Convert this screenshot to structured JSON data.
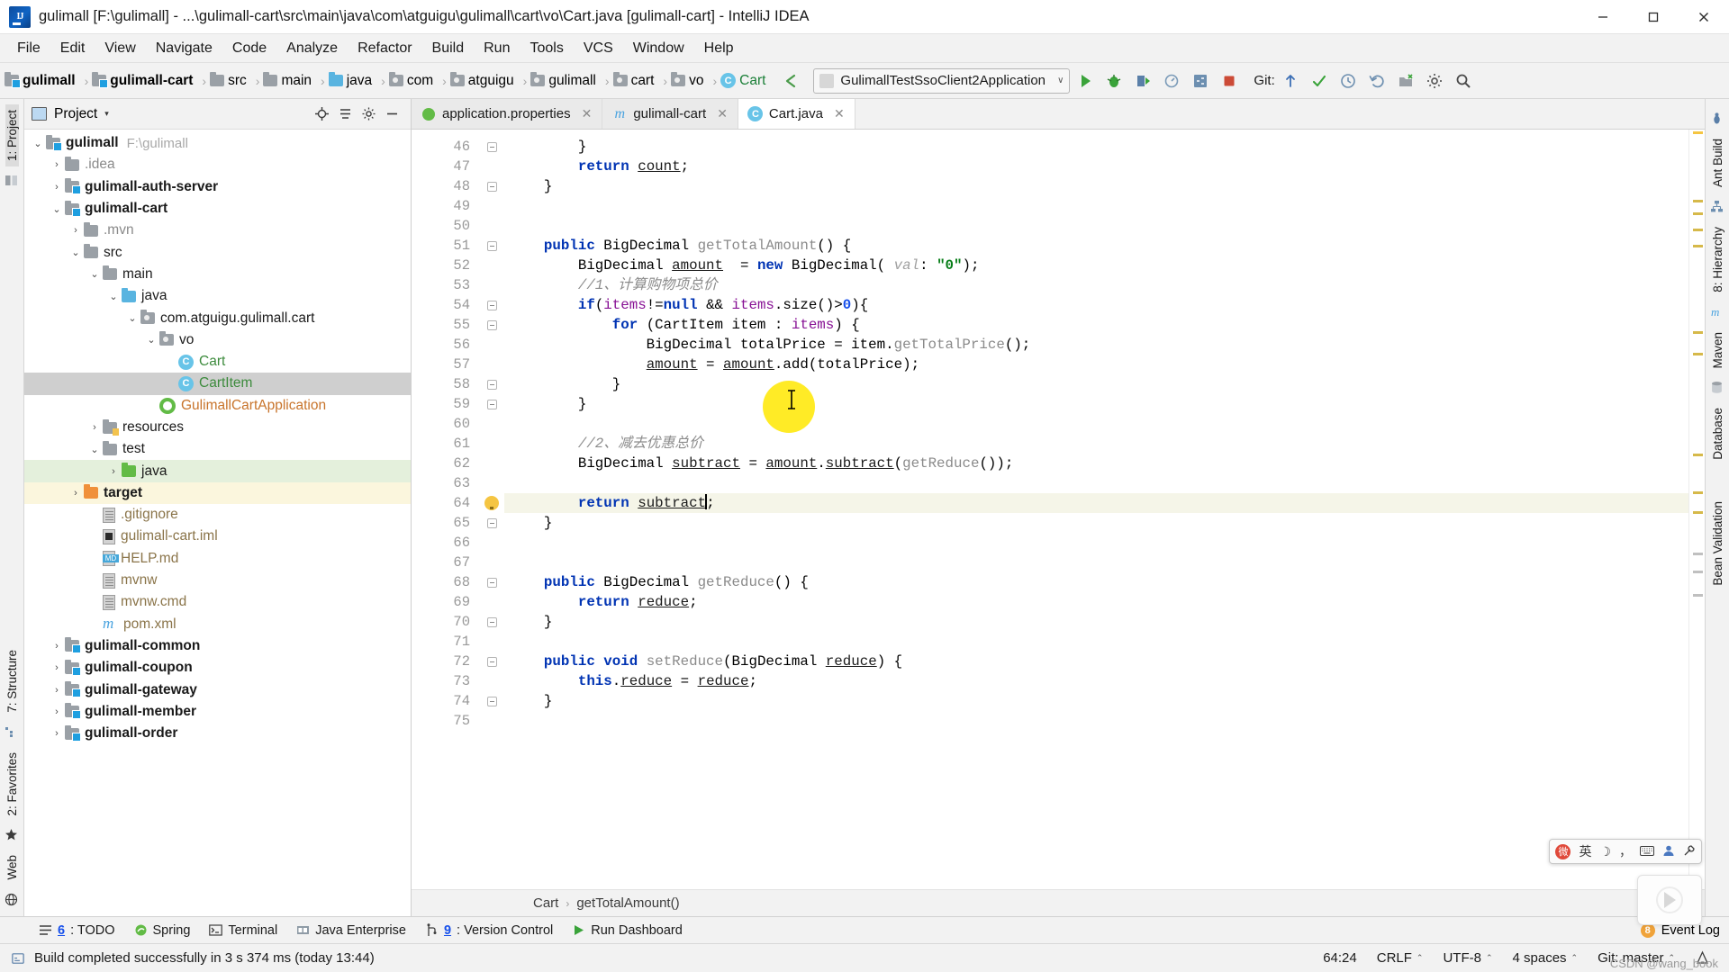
{
  "window": {
    "title": "gulimall [F:\\gulimall] - ...\\gulimall-cart\\src\\main\\java\\com\\atguigu\\gulimall\\cart\\vo\\Cart.java [gulimall-cart] - IntelliJ IDEA",
    "logo_text": "IJ",
    "minimize": "─",
    "maximize": "☐",
    "close": "✕"
  },
  "menu": {
    "items": [
      "File",
      "Edit",
      "View",
      "Navigate",
      "Code",
      "Analyze",
      "Refactor",
      "Build",
      "Run",
      "Tools",
      "VCS",
      "Window",
      "Help"
    ]
  },
  "navbar": {
    "crumbs": [
      {
        "label": "gulimall",
        "icon": "module-folder-icon",
        "bold": true
      },
      {
        "label": "gulimall-cart",
        "icon": "module-folder-icon",
        "bold": true
      },
      {
        "label": "src",
        "icon": "folder-icon",
        "bold": false
      },
      {
        "label": "main",
        "icon": "folder-icon",
        "bold": false
      },
      {
        "label": "java",
        "icon": "source-folder-icon",
        "bold": false
      },
      {
        "label": "com",
        "icon": "package-icon",
        "bold": false
      },
      {
        "label": "atguigu",
        "icon": "package-icon",
        "bold": false
      },
      {
        "label": "gulimall",
        "icon": "package-icon",
        "bold": false
      },
      {
        "label": "cart",
        "icon": "package-icon",
        "bold": false
      },
      {
        "label": "vo",
        "icon": "package-icon",
        "bold": false
      },
      {
        "label": "Cart",
        "icon": "class-icon",
        "bold": false,
        "green": true
      }
    ],
    "run_config": {
      "name": "GulimallTestSsoClient2Application",
      "arrow": "∨"
    },
    "git_label": "Git:",
    "icons": [
      "back-arrow-icon",
      "run-icon",
      "debug-icon",
      "run-coverage-icon",
      "profiler-icon",
      "build-icon",
      "stop-icon",
      "git-update-icon",
      "git-commit-icon",
      "git-history-icon",
      "git-rollback-icon",
      "select-in-icon",
      "settings-icon",
      "search-everywhere-icon"
    ]
  },
  "left_rail": {
    "items": [
      "1: Project",
      "7: Structure",
      "2: Favorites",
      "Web"
    ]
  },
  "right_rail": {
    "items": [
      "Ant Build",
      "8: Hierarchy",
      "Maven",
      "Database",
      "Bean Validation"
    ]
  },
  "project_panel": {
    "title": "Project",
    "caret": "▾",
    "tree": [
      {
        "depth": 0,
        "arrow": "⌄",
        "icon": "module-folder-icon",
        "label": "gulimall",
        "sub": "F:\\gulimall",
        "bold": true
      },
      {
        "depth": 1,
        "arrow": "›",
        "icon": "folder-icon",
        "label": ".idea",
        "color": "gray"
      },
      {
        "depth": 1,
        "arrow": "›",
        "icon": "module-folder-icon",
        "label": "gulimall-auth-server",
        "bold": true
      },
      {
        "depth": 1,
        "arrow": "⌄",
        "icon": "module-folder-icon",
        "label": "gulimall-cart",
        "bold": true
      },
      {
        "depth": 2,
        "arrow": "›",
        "icon": "folder-icon",
        "label": ".mvn",
        "color": "gray"
      },
      {
        "depth": 2,
        "arrow": "⌄",
        "icon": "folder-icon",
        "label": "src"
      },
      {
        "depth": 3,
        "arrow": "⌄",
        "icon": "folder-icon",
        "label": "main"
      },
      {
        "depth": 4,
        "arrow": "⌄",
        "icon": "source-folder-icon",
        "label": "java"
      },
      {
        "depth": 5,
        "arrow": "⌄",
        "icon": "package-icon",
        "label": "com.atguigu.gulimall.cart"
      },
      {
        "depth": 6,
        "arrow": "⌄",
        "icon": "package-icon",
        "label": "vo"
      },
      {
        "depth": 7,
        "arrow": "",
        "icon": "class-icon",
        "label": "Cart",
        "color": "green"
      },
      {
        "depth": 7,
        "arrow": "",
        "icon": "class-icon",
        "label": "CartItem",
        "color": "green",
        "selected": true
      },
      {
        "depth": 6,
        "arrow": "",
        "icon": "spring-class-icon",
        "label": "GulimallCartApplication",
        "color": "orange"
      },
      {
        "depth": 3,
        "arrow": "›",
        "icon": "resources-folder-icon",
        "label": "resources"
      },
      {
        "depth": 3,
        "arrow": "⌄",
        "icon": "folder-icon",
        "label": "test"
      },
      {
        "depth": 4,
        "arrow": "›",
        "icon": "test-source-folder-icon",
        "label": "java",
        "bg": "green"
      },
      {
        "depth": 2,
        "arrow": "›",
        "icon": "excluded-folder-icon",
        "label": "target",
        "bold": true,
        "bg": "yellow"
      },
      {
        "depth": 3,
        "arrow": "",
        "icon": "file-icon",
        "label": ".gitignore",
        "color": "tan"
      },
      {
        "depth": 3,
        "arrow": "",
        "icon": "iml-file-icon",
        "label": "gulimall-cart.iml",
        "color": "tan"
      },
      {
        "depth": 3,
        "arrow": "",
        "icon": "markdown-file-icon",
        "label": "HELP.md",
        "color": "tan"
      },
      {
        "depth": 3,
        "arrow": "",
        "icon": "file-icon",
        "label": "mvnw",
        "color": "tan"
      },
      {
        "depth": 3,
        "arrow": "",
        "icon": "file-icon",
        "label": "mvnw.cmd",
        "color": "tan"
      },
      {
        "depth": 3,
        "arrow": "",
        "icon": "maven-file-icon",
        "label": "pom.xml",
        "color": "tan"
      },
      {
        "depth": 1,
        "arrow": "›",
        "icon": "module-folder-icon",
        "label": "gulimall-common",
        "bold": true
      },
      {
        "depth": 1,
        "arrow": "›",
        "icon": "module-folder-icon",
        "label": "gulimall-coupon",
        "bold": true
      },
      {
        "depth": 1,
        "arrow": "›",
        "icon": "module-folder-icon",
        "label": "gulimall-gateway",
        "bold": true
      },
      {
        "depth": 1,
        "arrow": "›",
        "icon": "module-folder-icon",
        "label": "gulimall-member",
        "bold": true
      },
      {
        "depth": 1,
        "arrow": "›",
        "icon": "module-folder-icon",
        "label": "gulimall-order",
        "bold": true
      }
    ]
  },
  "editor": {
    "tabs": [
      {
        "label": "application.properties",
        "icon": "spring-properties-icon",
        "active": false,
        "close": "✕"
      },
      {
        "label": "gulimall-cart",
        "icon": "maven-icon",
        "active": false,
        "close": "✕"
      },
      {
        "label": "Cart.java",
        "icon": "class-icon",
        "active": true,
        "close": "✕"
      }
    ],
    "first_line": 46,
    "lines": [
      {
        "n": 46,
        "fold": "end",
        "text": "        }"
      },
      {
        "n": 47,
        "fold": "",
        "text": "        return count;"
      },
      {
        "n": 48,
        "fold": "end",
        "text": "    }"
      },
      {
        "n": 49,
        "fold": "",
        "text": ""
      },
      {
        "n": 50,
        "fold": "",
        "text": ""
      },
      {
        "n": 51,
        "fold": "start",
        "text": "    public BigDecimal getTotalAmount() {"
      },
      {
        "n": 52,
        "fold": "",
        "text": "        BigDecimal amount  = new BigDecimal( val: \"0\");"
      },
      {
        "n": 53,
        "fold": "",
        "text": "        //1、计算购物项总价"
      },
      {
        "n": 54,
        "fold": "start",
        "text": "        if(items!=null && items.size()>0){"
      },
      {
        "n": 55,
        "fold": "start",
        "text": "            for (CartItem item : items) {"
      },
      {
        "n": 56,
        "fold": "",
        "text": "                BigDecimal totalPrice = item.getTotalPrice();"
      },
      {
        "n": 57,
        "fold": "",
        "text": "                amount = amount.add(totalPrice);"
      },
      {
        "n": 58,
        "fold": "end",
        "text": "            }"
      },
      {
        "n": 59,
        "fold": "end",
        "text": "        }"
      },
      {
        "n": 60,
        "fold": "",
        "text": ""
      },
      {
        "n": 61,
        "fold": "",
        "text": "        //2、减去优惠总价"
      },
      {
        "n": 62,
        "fold": "",
        "text": "        BigDecimal subtract = amount.subtract(getReduce());"
      },
      {
        "n": 63,
        "fold": "",
        "text": ""
      },
      {
        "n": 64,
        "fold": "bulb",
        "text": "        return subtract;",
        "highlight": true
      },
      {
        "n": 65,
        "fold": "end",
        "text": "    }"
      },
      {
        "n": 66,
        "fold": "",
        "text": ""
      },
      {
        "n": 67,
        "fold": "",
        "text": ""
      },
      {
        "n": 68,
        "fold": "start",
        "text": "    public BigDecimal getReduce() {"
      },
      {
        "n": 69,
        "fold": "",
        "text": "        return reduce;"
      },
      {
        "n": 70,
        "fold": "end",
        "text": "    }"
      },
      {
        "n": 71,
        "fold": "",
        "text": ""
      },
      {
        "n": 72,
        "fold": "start",
        "text": "    public void setReduce(BigDecimal reduce) {"
      },
      {
        "n": 73,
        "fold": "",
        "text": "        this.reduce = reduce;"
      },
      {
        "n": 74,
        "fold": "end",
        "text": "    }"
      },
      {
        "n": 75,
        "fold": "",
        "text": ""
      }
    ],
    "breadcrumb": [
      "Cart",
      "getTotalAmount()"
    ],
    "breadcrumb_sep": "›"
  },
  "bottom_toolwindows": [
    {
      "num": "6",
      "label": ": TODO",
      "icon": "todo-icon"
    },
    {
      "num": "",
      "label": "Spring",
      "icon": "spring-icon"
    },
    {
      "num": "",
      "label": "Terminal",
      "icon": "terminal-icon"
    },
    {
      "num": "",
      "label": "Java Enterprise",
      "icon": "java-enterprise-icon"
    },
    {
      "num": "9",
      "label": ": Version Control",
      "icon": "version-control-icon"
    },
    {
      "num": "",
      "label": "Run Dashboard",
      "icon": "run-dashboard-icon"
    }
  ],
  "event_log": {
    "label": "Event Log",
    "badge": "8"
  },
  "statusbar": {
    "message": "Build completed successfully in 3 s 374 ms (today 13:44)",
    "caret_position": "64:24",
    "line_separator": "CRLF",
    "encoding": "UTF-8",
    "indent": "4 spaces",
    "git_branch": "Git: master",
    "chevron": "⌃"
  },
  "ime_bar": {
    "logo": "微",
    "mode": "英",
    "items": [
      "moon-icon",
      "comma-icon",
      "keyboard-icon",
      "user-icon",
      "tools-icon"
    ]
  },
  "watermark": "CSDN @wang_book",
  "colors": {
    "accent_blue": "#1f9fe0",
    "keyword": "#0033b3",
    "string": "#067d17",
    "number": "#1750eb",
    "comment": "#8c8c8c",
    "field": "#871094",
    "method_gray": "#8a8a8a",
    "highlight_line": "#f5f5e8",
    "selection": "#cfcfcf",
    "cursor_halo": "#ffe800"
  }
}
